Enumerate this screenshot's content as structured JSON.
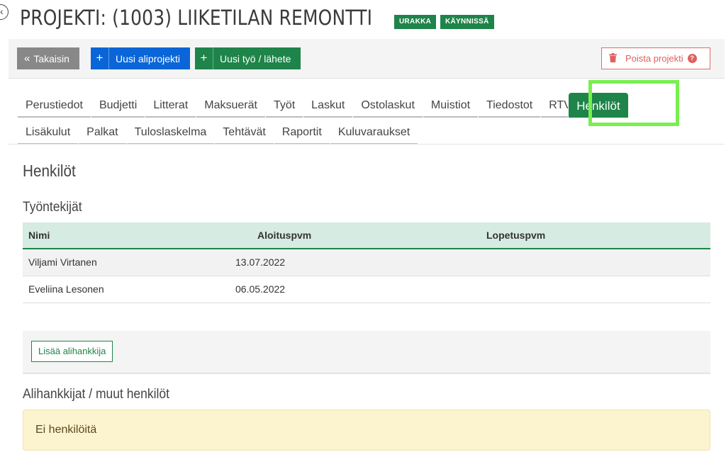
{
  "header": {
    "title": "PROJEKTI: (1003) LIIKETILAN REMONTTI",
    "badges": [
      "URAKKA",
      "KÄYNNISSÄ"
    ],
    "back_icon": "chevron-left-circle-icon"
  },
  "toolbar": {
    "back_label": "Takaisin",
    "new_subproject_label": "Uusi aliprojekti",
    "new_work_label": "Uusi työ / lähete",
    "delete_label": "Poista projekti",
    "help_glyph": "?"
  },
  "tabs": {
    "row1": [
      "Perustiedot",
      "Budjetti",
      "Litterat",
      "Maksuerät",
      "Työt",
      "Laskut",
      "Ostolaskut",
      "Muistiot",
      "Tiedostot",
      "RTV",
      "Henkilöt"
    ],
    "row2": [
      "Lisäkulut",
      "Palkat",
      "Tuloslaskelma",
      "Tehtävät",
      "Raportit",
      "Kuluvaraukset"
    ],
    "active": "Henkilöt"
  },
  "main": {
    "section_title": "Henkilöt",
    "employees_title": "Työntekijät",
    "columns": [
      "Nimi",
      "Aloituspvm",
      "Lopetuspvm"
    ],
    "rows": [
      {
        "name": "Viljami Virtanen",
        "start": "13.07.2022",
        "end": ""
      },
      {
        "name": "Eveliina Lesonen",
        "start": "06.05.2022",
        "end": ""
      }
    ],
    "add_subcontractor_label": "Lisää alihankkija",
    "subcontractors_title": "Alihankkijat / muut henkilöt",
    "empty_message": "Ei henkilöitä"
  },
  "colors": {
    "accent_green": "#1e8449",
    "primary_blue": "#0a66d8",
    "danger_red": "#e06060",
    "highlight": "#79ef4f"
  }
}
